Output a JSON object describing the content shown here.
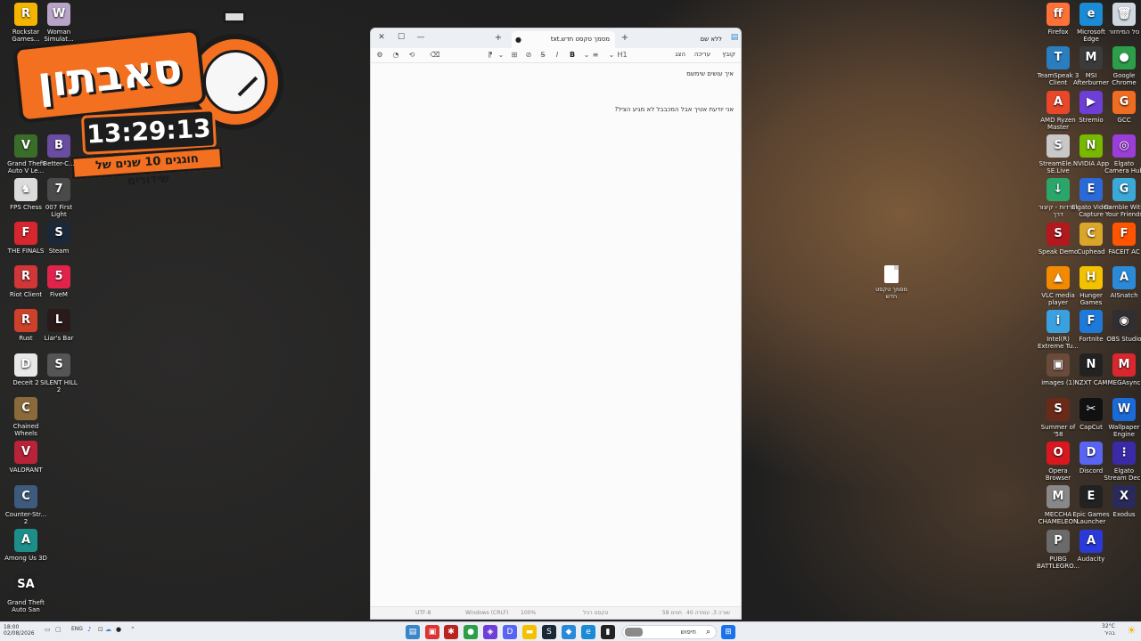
{
  "overlay": {
    "brand_text": "סאבתון",
    "clock": "13:29:13",
    "tagline": "חוגגים 10 שנים של שידורים"
  },
  "left_icons": [
    {
      "label": "Rockstar Games...",
      "icon": "rockstar-icon",
      "color": "#f4b400",
      "glyph": "R"
    },
    {
      "label": "Woman Simulat...",
      "icon": "woman-simulator-icon",
      "color": "#b8a4c8",
      "glyph": "W"
    },
    {
      "label": "Grand Theft Auto V Le...",
      "icon": "gta5-icon",
      "color": "#3b6d2a",
      "glyph": "V"
    },
    {
      "label": "Better-C...",
      "icon": "betterc-icon",
      "color": "#6a4ca0",
      "glyph": "B"
    },
    {
      "label": "FPS Chess",
      "icon": "fps-chess-icon",
      "color": "#dcdcdc",
      "glyph": "♞"
    },
    {
      "label": "007 First Light",
      "icon": "007-icon",
      "color": "#4a4a4a",
      "glyph": "7"
    },
    {
      "label": "THE FINALS",
      "icon": "the-finals-icon",
      "color": "#d8262e",
      "glyph": "F"
    },
    {
      "label": "Steam",
      "icon": "steam-icon",
      "color": "#1b2838",
      "glyph": "S"
    },
    {
      "label": "Riot Client",
      "icon": "riot-icon",
      "color": "#d13639",
      "glyph": "R"
    },
    {
      "label": "FiveM",
      "icon": "fivem-icon",
      "color": "#e1234c",
      "glyph": "5"
    },
    {
      "label": "Rust",
      "icon": "rust-icon",
      "color": "#cd412b",
      "glyph": "R"
    },
    {
      "label": "Liar's Bar",
      "icon": "liars-bar-icon",
      "color": "#2a1a1a",
      "glyph": "L"
    },
    {
      "label": "Deceit 2",
      "icon": "deceit-icon",
      "color": "#e8e8e8",
      "glyph": "D"
    },
    {
      "label": "SILENT HILL 2",
      "icon": "silent-hill-icon",
      "color": "#555",
      "glyph": "S"
    },
    {
      "label": "Chained Wheels",
      "icon": "chained-wheels-icon",
      "color": "#8a6a3a",
      "glyph": "C"
    },
    {
      "label": "VALORANT",
      "icon": "valorant-icon",
      "color": "#b8233a",
      "glyph": "V"
    },
    {
      "label": "Counter-Str... 2",
      "icon": "cs2-icon",
      "color": "#3e5a7c",
      "glyph": "C"
    },
    {
      "label": "Among Us 3D",
      "icon": "among-us-icon",
      "color": "#1d8f8a",
      "glyph": "A"
    },
    {
      "label": "Grand Theft Auto San An...",
      "icon": "gta-sa-icon",
      "color": "#222",
      "glyph": "SA"
    }
  ],
  "right_icons": [
    {
      "label": "Firefox",
      "icon": "firefox-icon",
      "color": "#ff7139",
      "glyph": "ff"
    },
    {
      "label": "Microsoft Edge",
      "icon": "edge-icon",
      "color": "#1b8bd6",
      "glyph": "e"
    },
    {
      "label": "סל המיחזור",
      "icon": "recycle-bin-icon",
      "color": "#cfd8e0",
      "glyph": "🗑"
    },
    {
      "label": "TeamSpeak 3 Client",
      "icon": "teamspeak-icon",
      "color": "#2a7ec0",
      "glyph": "T"
    },
    {
      "label": "MSI Afterburner",
      "icon": "msi-afterburner-icon",
      "color": "#3b3b3b",
      "glyph": "M"
    },
    {
      "label": "Google Chrome",
      "icon": "chrome-icon",
      "color": "#2c9e4a",
      "glyph": "●"
    },
    {
      "label": "AMD Ryzen Master",
      "icon": "amd-ryzen-icon",
      "color": "#e8472a",
      "glyph": "A"
    },
    {
      "label": "Stremio",
      "icon": "stremio-icon",
      "color": "#6e3fd6",
      "glyph": "▶"
    },
    {
      "label": "GCC",
      "icon": "gcc-icon",
      "color": "#ef6c21",
      "glyph": "G"
    },
    {
      "label": "StreamEle... SE.Live",
      "icon": "streamelements-icon",
      "color": "#c8c8c8",
      "glyph": "S"
    },
    {
      "label": "NVIDIA App",
      "icon": "nvidia-icon",
      "color": "#76b900",
      "glyph": "N"
    },
    {
      "label": "Elgato Camera Hub",
      "icon": "elgato-camera-icon",
      "color": "#9b3dd8",
      "glyph": "◎"
    },
    {
      "label": "הורדות - קיצור דרך",
      "icon": "downloads-icon",
      "color": "#2aa66a",
      "glyph": "↓"
    },
    {
      "label": "Elgato Video Capture",
      "icon": "elgato-capture-icon",
      "color": "#2a6ad8",
      "glyph": "E"
    },
    {
      "label": "Gamble With Your Friends",
      "icon": "gamble-icon",
      "color": "#3aa8d8",
      "glyph": "G"
    },
    {
      "label": "Speak Demo",
      "icon": "speak-demo-icon",
      "color": "#b3181e",
      "glyph": "S"
    },
    {
      "label": "Cuphead",
      "icon": "cuphead-icon",
      "color": "#d9a52a",
      "glyph": "C"
    },
    {
      "label": "FACEIT AC",
      "icon": "faceit-icon",
      "color": "#ff5500",
      "glyph": "F"
    },
    {
      "label": "VLC media player",
      "icon": "vlc-icon",
      "color": "#f28a00",
      "glyph": "▲"
    },
    {
      "label": "Hunger Games",
      "icon": "hunger-games-icon",
      "color": "#f2c200",
      "glyph": "H"
    },
    {
      "label": "AISnatch",
      "icon": "aisnatch-icon",
      "color": "#2a8ad8",
      "glyph": "A"
    },
    {
      "label": "Intel(R) Extreme Tu...",
      "icon": "intel-xtu-icon",
      "color": "#3aa0e0",
      "glyph": "i"
    },
    {
      "label": "Fortnite",
      "icon": "fortnite-icon",
      "color": "#1d7ad8",
      "glyph": "F"
    },
    {
      "label": "OBS Studio",
      "icon": "obs-icon",
      "color": "#302e31",
      "glyph": "◉"
    },
    {
      "label": "images (1)",
      "icon": "image-file-icon",
      "color": "#6a4a3a",
      "glyph": "▣"
    },
    {
      "label": "NZXT CAM",
      "icon": "nzxt-icon",
      "color": "#222",
      "glyph": "N"
    },
    {
      "label": "MEGAsync",
      "icon": "megasync-icon",
      "color": "#d9272e",
      "glyph": "M"
    },
    {
      "label": "Summer of '58",
      "icon": "summer58-icon",
      "color": "#6a2a1a",
      "glyph": "S"
    },
    {
      "label": "CapCut",
      "icon": "capcut-icon",
      "color": "#111",
      "glyph": "✂"
    },
    {
      "label": "Wallpaper Engine",
      "icon": "wallpaper-engine-icon",
      "color": "#1a6ad8",
      "glyph": "W"
    },
    {
      "label": "Opera Browser",
      "icon": "opera-icon",
      "color": "#d8181e",
      "glyph": "O"
    },
    {
      "label": "Discord",
      "icon": "discord-icon",
      "color": "#5865f2",
      "glyph": "D"
    },
    {
      "label": "Elgato Stream Deck",
      "icon": "stream-deck-icon",
      "color": "#3a2aa8",
      "glyph": "⋮"
    },
    {
      "label": "MECCHA CHAMELEON",
      "icon": "meccha-icon",
      "color": "#888",
      "glyph": "M"
    },
    {
      "label": "Epic Games Launcher",
      "icon": "epic-games-icon",
      "color": "#222",
      "glyph": "E"
    },
    {
      "label": "Exodus",
      "icon": "exodus-icon",
      "color": "#2a2a5a",
      "glyph": "X"
    },
    {
      "label": "PUBG BATTLEGRO...",
      "icon": "pubg-icon",
      "color": "#6a6a6a",
      "glyph": "P"
    },
    {
      "label": "Audacity",
      "icon": "audacity-icon",
      "color": "#2a3ad8",
      "glyph": "A"
    }
  ],
  "desktop_file": {
    "label": "מסמך טקסט חדש",
    "icon": "text-file-icon"
  },
  "notepad": {
    "window_tab_inactive": "ללא שם",
    "window_tab_active": "מסמך טקסט חדש.txt",
    "menu": {
      "file": "קובץ",
      "edit": "עריכה",
      "view": "הצג"
    },
    "toolbar": {
      "heading": "H1",
      "bold": "B",
      "italic": "I"
    },
    "lines": [
      "איך עושים שימשמ",
      "אני יודעת אטיך אבל המכבבל לא מגיע הציל?"
    ],
    "status": {
      "position": "שורה 3, עמודה 40",
      "chars": "58 תווים",
      "format": "טקסט רגיל",
      "zoom": "100%",
      "eol": "Windows (CRLF)",
      "encoding": "UTF-8"
    }
  },
  "taskbar": {
    "search_placeholder": "חיפוש",
    "weather_temp": "32°C",
    "weather_desc": "בהיר",
    "clock_time": "18:00",
    "clock_date": "02/08/2026",
    "language": "ENG"
  }
}
